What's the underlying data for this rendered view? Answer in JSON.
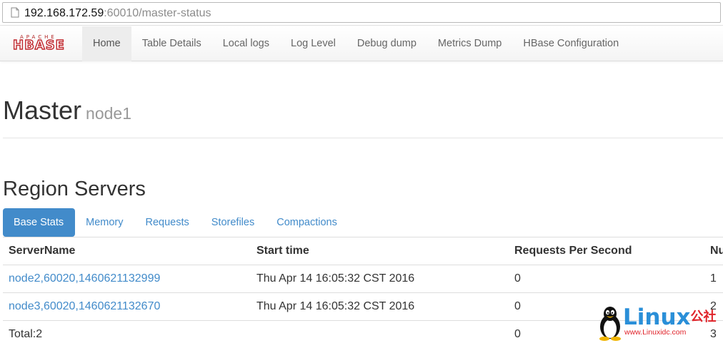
{
  "browser": {
    "url_host": "192.168.172.59",
    "url_rest": ":60010/master-status"
  },
  "navbar": {
    "logo_top": "APACHE",
    "logo_main": "HBASE",
    "items": [
      {
        "label": "Home",
        "active": true
      },
      {
        "label": "Table Details"
      },
      {
        "label": "Local logs"
      },
      {
        "label": "Log Level"
      },
      {
        "label": "Debug dump"
      },
      {
        "label": "Metrics Dump"
      },
      {
        "label": "HBase Configuration"
      }
    ]
  },
  "master": {
    "title": "Master",
    "node": "node1"
  },
  "region_servers": {
    "title": "Region Servers",
    "tabs": [
      {
        "label": "Base Stats",
        "active": true
      },
      {
        "label": "Memory"
      },
      {
        "label": "Requests"
      },
      {
        "label": "Storefiles"
      },
      {
        "label": "Compactions"
      }
    ],
    "columns": [
      "ServerName",
      "Start time",
      "Requests Per Second",
      "Nu"
    ],
    "rows": [
      [
        "node2,60020,1460621132999",
        "Thu Apr 14 16:05:32 CST 2016",
        "0",
        "1"
      ],
      [
        "node3,60020,1460621132670",
        "Thu Apr 14 16:05:32 CST 2016",
        "0",
        "2"
      ]
    ],
    "total": {
      "label": "Total:2",
      "requests": "0",
      "num": "3"
    }
  },
  "watermark": {
    "brand": "Linux",
    "brand_cn": "公社",
    "url": "www.Linuxidc.com"
  },
  "colors": {
    "link": "#428bca",
    "active_tab_bg": "#428bca",
    "logo_red": "#c0272d",
    "watermark_blue": "#2a8fd8",
    "watermark_red": "#e0242b"
  }
}
